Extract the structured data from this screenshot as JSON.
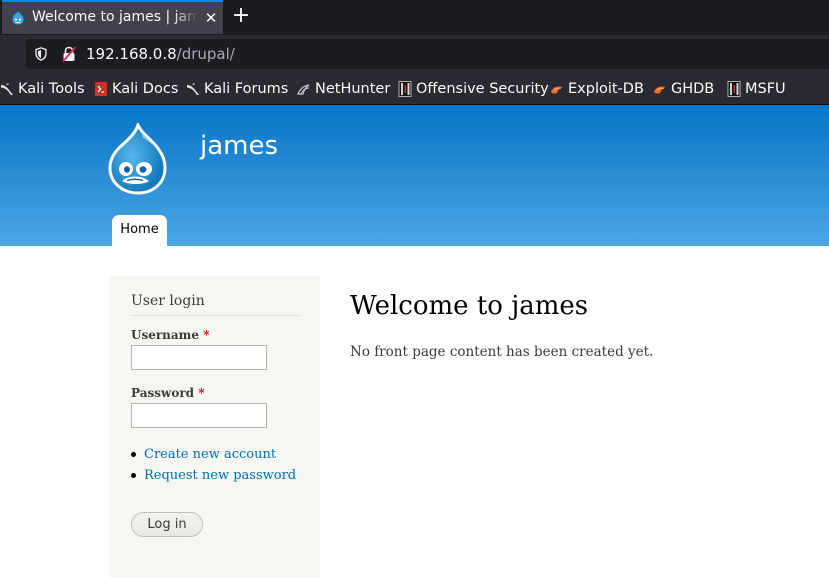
{
  "browser": {
    "tab": {
      "title": "Welcome to james | james",
      "close_glyph": "✕"
    },
    "new_tab_glyph": "+",
    "url": {
      "host": "192.168.0.8",
      "path": "/drupal/"
    },
    "bookmarks": [
      {
        "label": "Kali Tools",
        "icon": "kali-dragon-icon"
      },
      {
        "label": "Kali Docs",
        "icon": "kali-docs-icon"
      },
      {
        "label": "Kali Forums",
        "icon": "kali-dragon-icon"
      },
      {
        "label": "NetHunter",
        "icon": "nethunter-icon"
      },
      {
        "label": "Offensive Security",
        "icon": "offsec-icon"
      },
      {
        "label": "Exploit-DB",
        "icon": "exploitdb-icon"
      },
      {
        "label": "GHDB",
        "icon": "exploitdb-icon"
      },
      {
        "label": "MSFU",
        "icon": "offsec-icon"
      }
    ],
    "colors": {
      "tab_strip": "#1c1b22",
      "toolbar": "#2b2a33",
      "accent": "#0a84ff"
    }
  },
  "site": {
    "name": "james",
    "nav": {
      "home_label": "Home"
    },
    "colors": {
      "header_top": "#0777c9",
      "header_bottom": "#4aa8e4",
      "link": "#0071b3"
    }
  },
  "login_block": {
    "title": "User login",
    "username_label": "Username",
    "password_label": "Password",
    "required_marker": "*",
    "username_value": "",
    "password_value": "",
    "links": [
      "Create new account",
      "Request new password"
    ],
    "submit_label": "Log in"
  },
  "main": {
    "title": "Welcome to james",
    "text": "No front page content has been created yet."
  }
}
